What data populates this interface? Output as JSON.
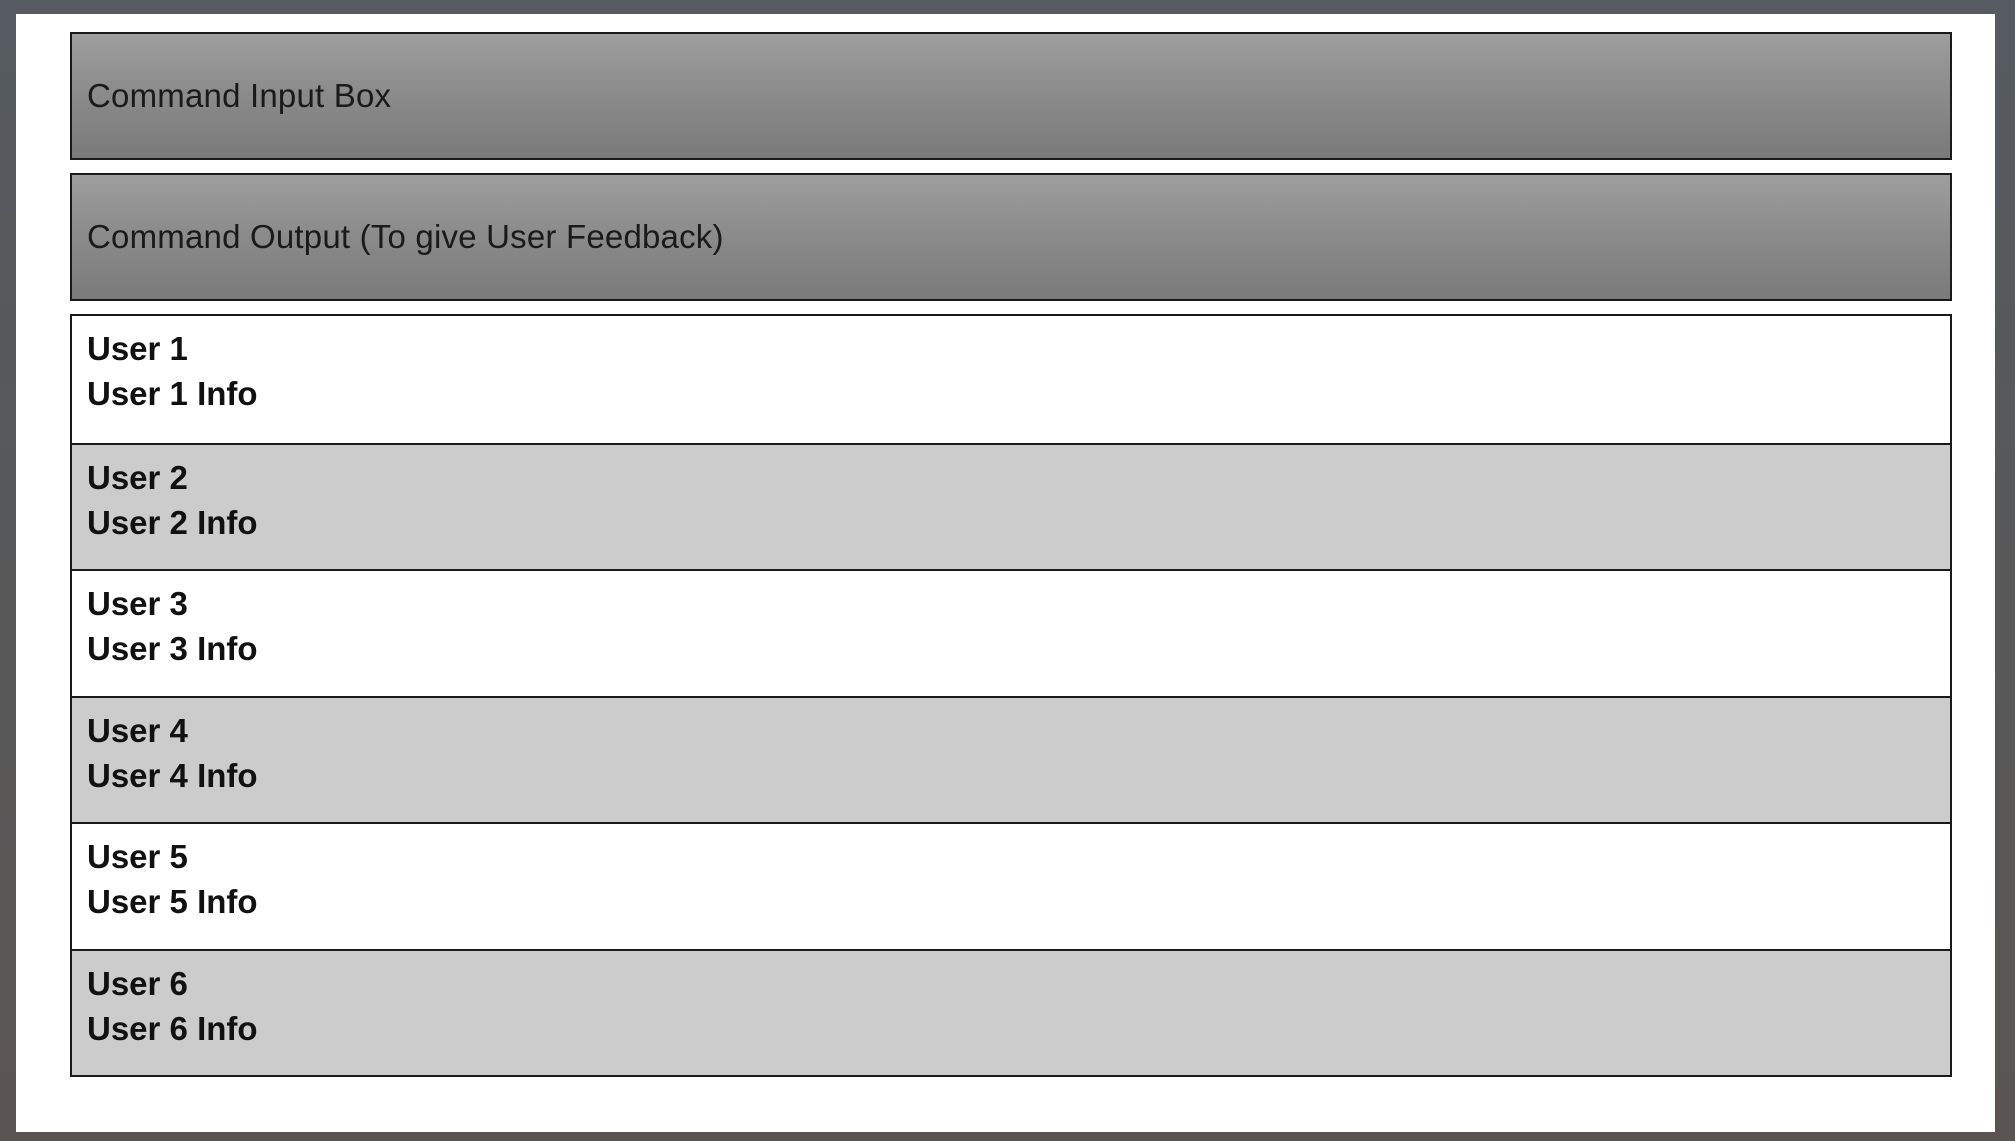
{
  "command_input": {
    "label": "Command Input Box"
  },
  "command_output": {
    "label": "Command Output (To give User Feedback)"
  },
  "users": [
    {
      "name": "User 1",
      "info": "User 1 Info"
    },
    {
      "name": "User 2",
      "info": "User 2 Info"
    },
    {
      "name": "User 3",
      "info": "User 3 Info"
    },
    {
      "name": "User 4",
      "info": "User 4 Info"
    },
    {
      "name": "User 5",
      "info": "User 5 Info"
    },
    {
      "name": "User 6",
      "info": "User 6 Info"
    }
  ],
  "colors": {
    "header_gradient_top": "#9e9e9e",
    "header_gradient_bottom": "#7a7a7a",
    "row_light": "#ffffff",
    "row_dark": "#cccccc",
    "border": "#1a1a1a"
  }
}
